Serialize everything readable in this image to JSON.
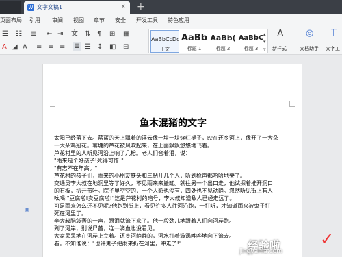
{
  "tabs": [
    {
      "label": "文字文稿1",
      "close": "×"
    }
  ],
  "add_tab": "+",
  "menu": [
    "页面布局",
    "引用",
    "审阅",
    "视图",
    "章节",
    "安全",
    "开发工具",
    "特色应用"
  ],
  "ribbon": {
    "styles": [
      {
        "sample": "AaBbCcDd",
        "name": "正文"
      },
      {
        "sample": "AaBb",
        "name": "标题 1"
      },
      {
        "sample": "AaBb(",
        "name": "标题 2"
      },
      {
        "sample": "AaBbC",
        "name": "标题 3"
      }
    ],
    "new_style": "新样式",
    "assistant": "文档助手",
    "text_tools": "文字工"
  },
  "document": {
    "title": "鱼木混猪的文字",
    "paragraphs": [
      "太阳已经落下去。蓝蓝的天上飘着的浮云像一块一块烧红褪子，映在还乡河上，像开了一大朵",
      "一大朵鸡冠花。苇塘的芦花被风吹起来，在上面飘飘悠悠地飞着。",
      "芦花村里的人听见河沿上响了几枪。老人们合着泪，说：",
      "\"雨来是个好孩子!死得可惜!\"",
      "\"有志不在年高。\"",
      "芦花村的孩子们，雨来的小朋友铁头和三钻儿几个人，听到枪声都哈哈地哭了。",
      "交通员李大叔在地洞里等了好久，不见雨来来搬缸。就往另一个出口走，他试探着推开洞口",
      "的石板，扒开带叶。院子里空空的，一个人影也没有，四处也不见动静。忽然听见街上有人",
      "吆喝:\"豆腐啦!卖豆腐啦!\"这是芦花村的暗号，李大叔知道敌人已经走远了。",
      "可是雨来怎么还不见呢?他跑到街上，看见许多人往河沿跑，一打听，才知道雨来被鬼子打",
      "死在河里了。",
      "李大叔脑袋轰的一声，眼泪就流下来了。他一般劲儿地跟着人们向河岸跑。",
      "到了河岸，别说尸首，连一滴血也没看见。",
      "大家呆呆地在河岸上立着。还乡河静静的，河水打着漩涡哗哗地向下流去。",
      "看。不知谁说：\"也许鬼子把雨来扔在河里，冲走了!\""
    ]
  },
  "watermark": {
    "text": "经验啦",
    "url": "jingyanla.com",
    "check": "✓"
  }
}
